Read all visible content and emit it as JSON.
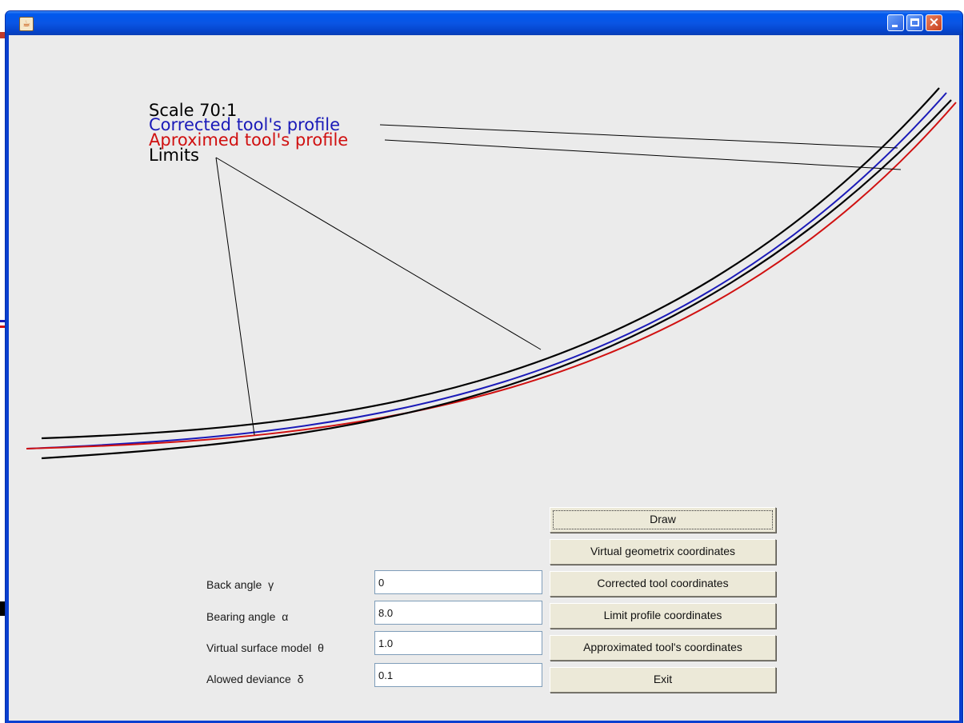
{
  "legend": {
    "scale": "Scale  70:1",
    "corrected": "Corrected tool's profile",
    "approximated": "Aproximed tool's profile",
    "limits": "Limits"
  },
  "colors": {
    "corrected": "#1a1ab8",
    "approximated": "#d01010",
    "limits": "#000000",
    "window_frame": "#0a3fd0",
    "client_bg": "#ebebeb"
  },
  "fields": [
    {
      "label": "Back angle",
      "symbol": "γ",
      "value": "0"
    },
    {
      "label": "Bearing angle",
      "symbol": "α",
      "value": "8.0"
    },
    {
      "label": "Virtual surface model",
      "symbol": "θ",
      "value": "1.0"
    },
    {
      "label": "Alowed deviance",
      "symbol": "δ",
      "value": "0.1"
    }
  ],
  "buttons": {
    "draw": "Draw",
    "virtual": "Virtual geometrix coordinates",
    "corrected": "Corrected tool coordinates",
    "limit": "Limit profile coordinates",
    "approximated": "Approximated tool's coordinates",
    "exit": "Exit"
  },
  "icons": {
    "app": "java-cup-icon",
    "minimize": "minimize-icon",
    "maximize": "maximize-icon",
    "close": "close-icon"
  }
}
